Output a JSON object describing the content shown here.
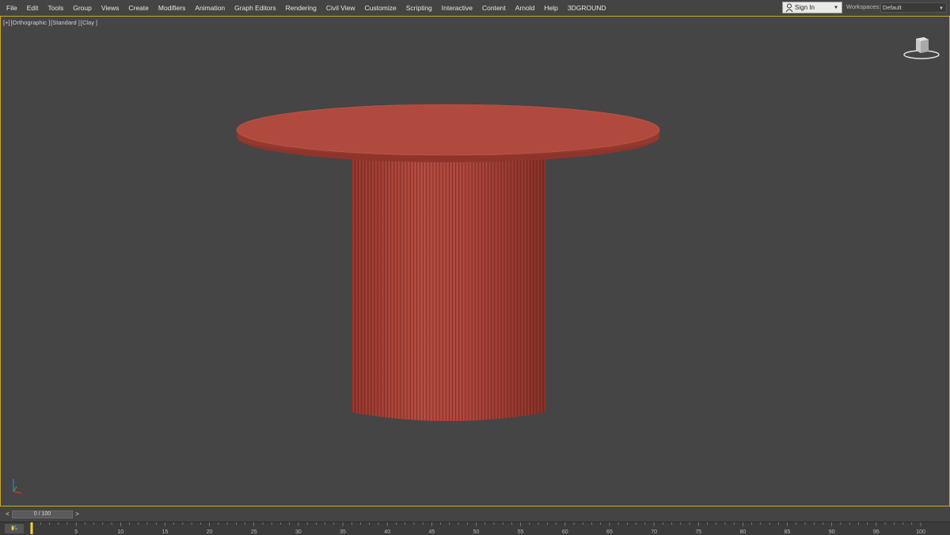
{
  "menu": {
    "items": [
      "File",
      "Edit",
      "Tools",
      "Group",
      "Views",
      "Create",
      "Modifiers",
      "Animation",
      "Graph Editors",
      "Rendering",
      "Civil View",
      "Customize",
      "Scripting",
      "Interactive",
      "Content",
      "Arnold",
      "Help",
      "3DGROUND"
    ]
  },
  "account": {
    "signin_label": "Sign In"
  },
  "workspace": {
    "label": "Workspaces:",
    "value": "Default"
  },
  "viewport": {
    "labels": [
      "[+]",
      "[Orthographic ]",
      "[Standard ]",
      "[Clay ]"
    ],
    "object": "round table with fluted cylindrical base",
    "object_color": "#b0473c"
  },
  "timeline": {
    "prev_label": "<",
    "next_label": ">",
    "frame_display": "0 / 100",
    "ticks": [
      "0",
      "5",
      "10",
      "15",
      "20",
      "25",
      "30",
      "35",
      "40",
      "45",
      "50",
      "55",
      "60",
      "65",
      "70",
      "75",
      "80",
      "85",
      "90",
      "95",
      "100"
    ]
  },
  "colors": {
    "viewport_bg": "#454545",
    "viewport_border": "#c9a72a",
    "accent_key": "#f0d040"
  }
}
